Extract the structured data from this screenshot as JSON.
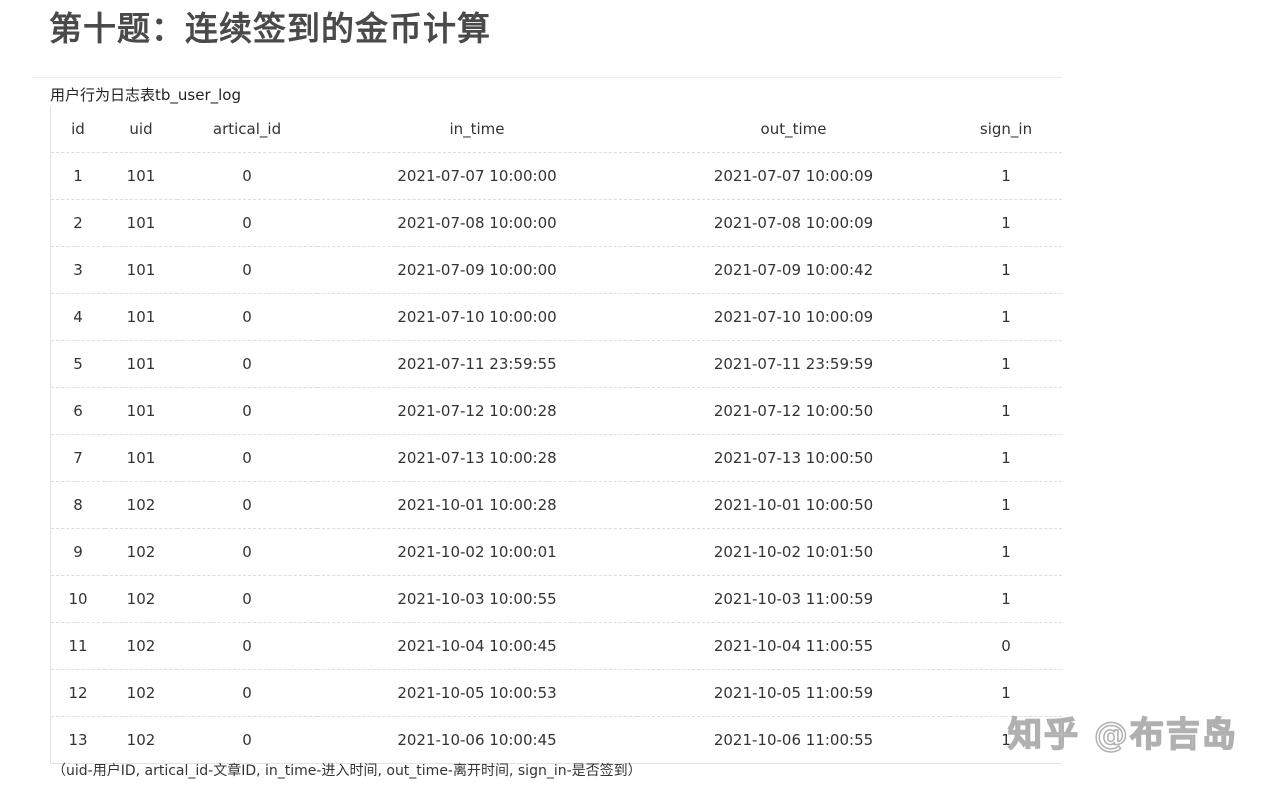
{
  "title": "第十题：连续签到的金币计算",
  "caption": "用户行为日志表tb_user_log",
  "table": {
    "headers": [
      "id",
      "uid",
      "artical_id",
      "in_time",
      "out_time",
      "sign_in"
    ],
    "rows": [
      [
        "1",
        "101",
        "0",
        "2021-07-07 10:00:00",
        "2021-07-07 10:00:09",
        "1"
      ],
      [
        "2",
        "101",
        "0",
        "2021-07-08 10:00:00",
        "2021-07-08 10:00:09",
        "1"
      ],
      [
        "3",
        "101",
        "0",
        "2021-07-09 10:00:00",
        "2021-07-09 10:00:42",
        "1"
      ],
      [
        "4",
        "101",
        "0",
        "2021-07-10 10:00:00",
        "2021-07-10 10:00:09",
        "1"
      ],
      [
        "5",
        "101",
        "0",
        "2021-07-11 23:59:55",
        "2021-07-11 23:59:59",
        "1"
      ],
      [
        "6",
        "101",
        "0",
        "2021-07-12 10:00:28",
        "2021-07-12 10:00:50",
        "1"
      ],
      [
        "7",
        "101",
        "0",
        "2021-07-13 10:00:28",
        "2021-07-13 10:00:50",
        "1"
      ],
      [
        "8",
        "102",
        "0",
        "2021-10-01 10:00:28",
        "2021-10-01 10:00:50",
        "1"
      ],
      [
        "9",
        "102",
        "0",
        "2021-10-02 10:00:01",
        "2021-10-02 10:01:50",
        "1"
      ],
      [
        "10",
        "102",
        "0",
        "2021-10-03 10:00:55",
        "2021-10-03 11:00:59",
        "1"
      ],
      [
        "11",
        "102",
        "0",
        "2021-10-04 10:00:45",
        "2021-10-04 11:00:55",
        "0"
      ],
      [
        "12",
        "102",
        "0",
        "2021-10-05 10:00:53",
        "2021-10-05 11:00:59",
        "1"
      ],
      [
        "13",
        "102",
        "0",
        "2021-10-06 10:00:45",
        "2021-10-06 11:00:55",
        "1"
      ]
    ]
  },
  "footnote": "（uid-用户ID, artical_id-文章ID, in_time-进入时间, out_time-离开时间, sign_in-是否签到）",
  "watermark": "知乎 @布吉岛"
}
